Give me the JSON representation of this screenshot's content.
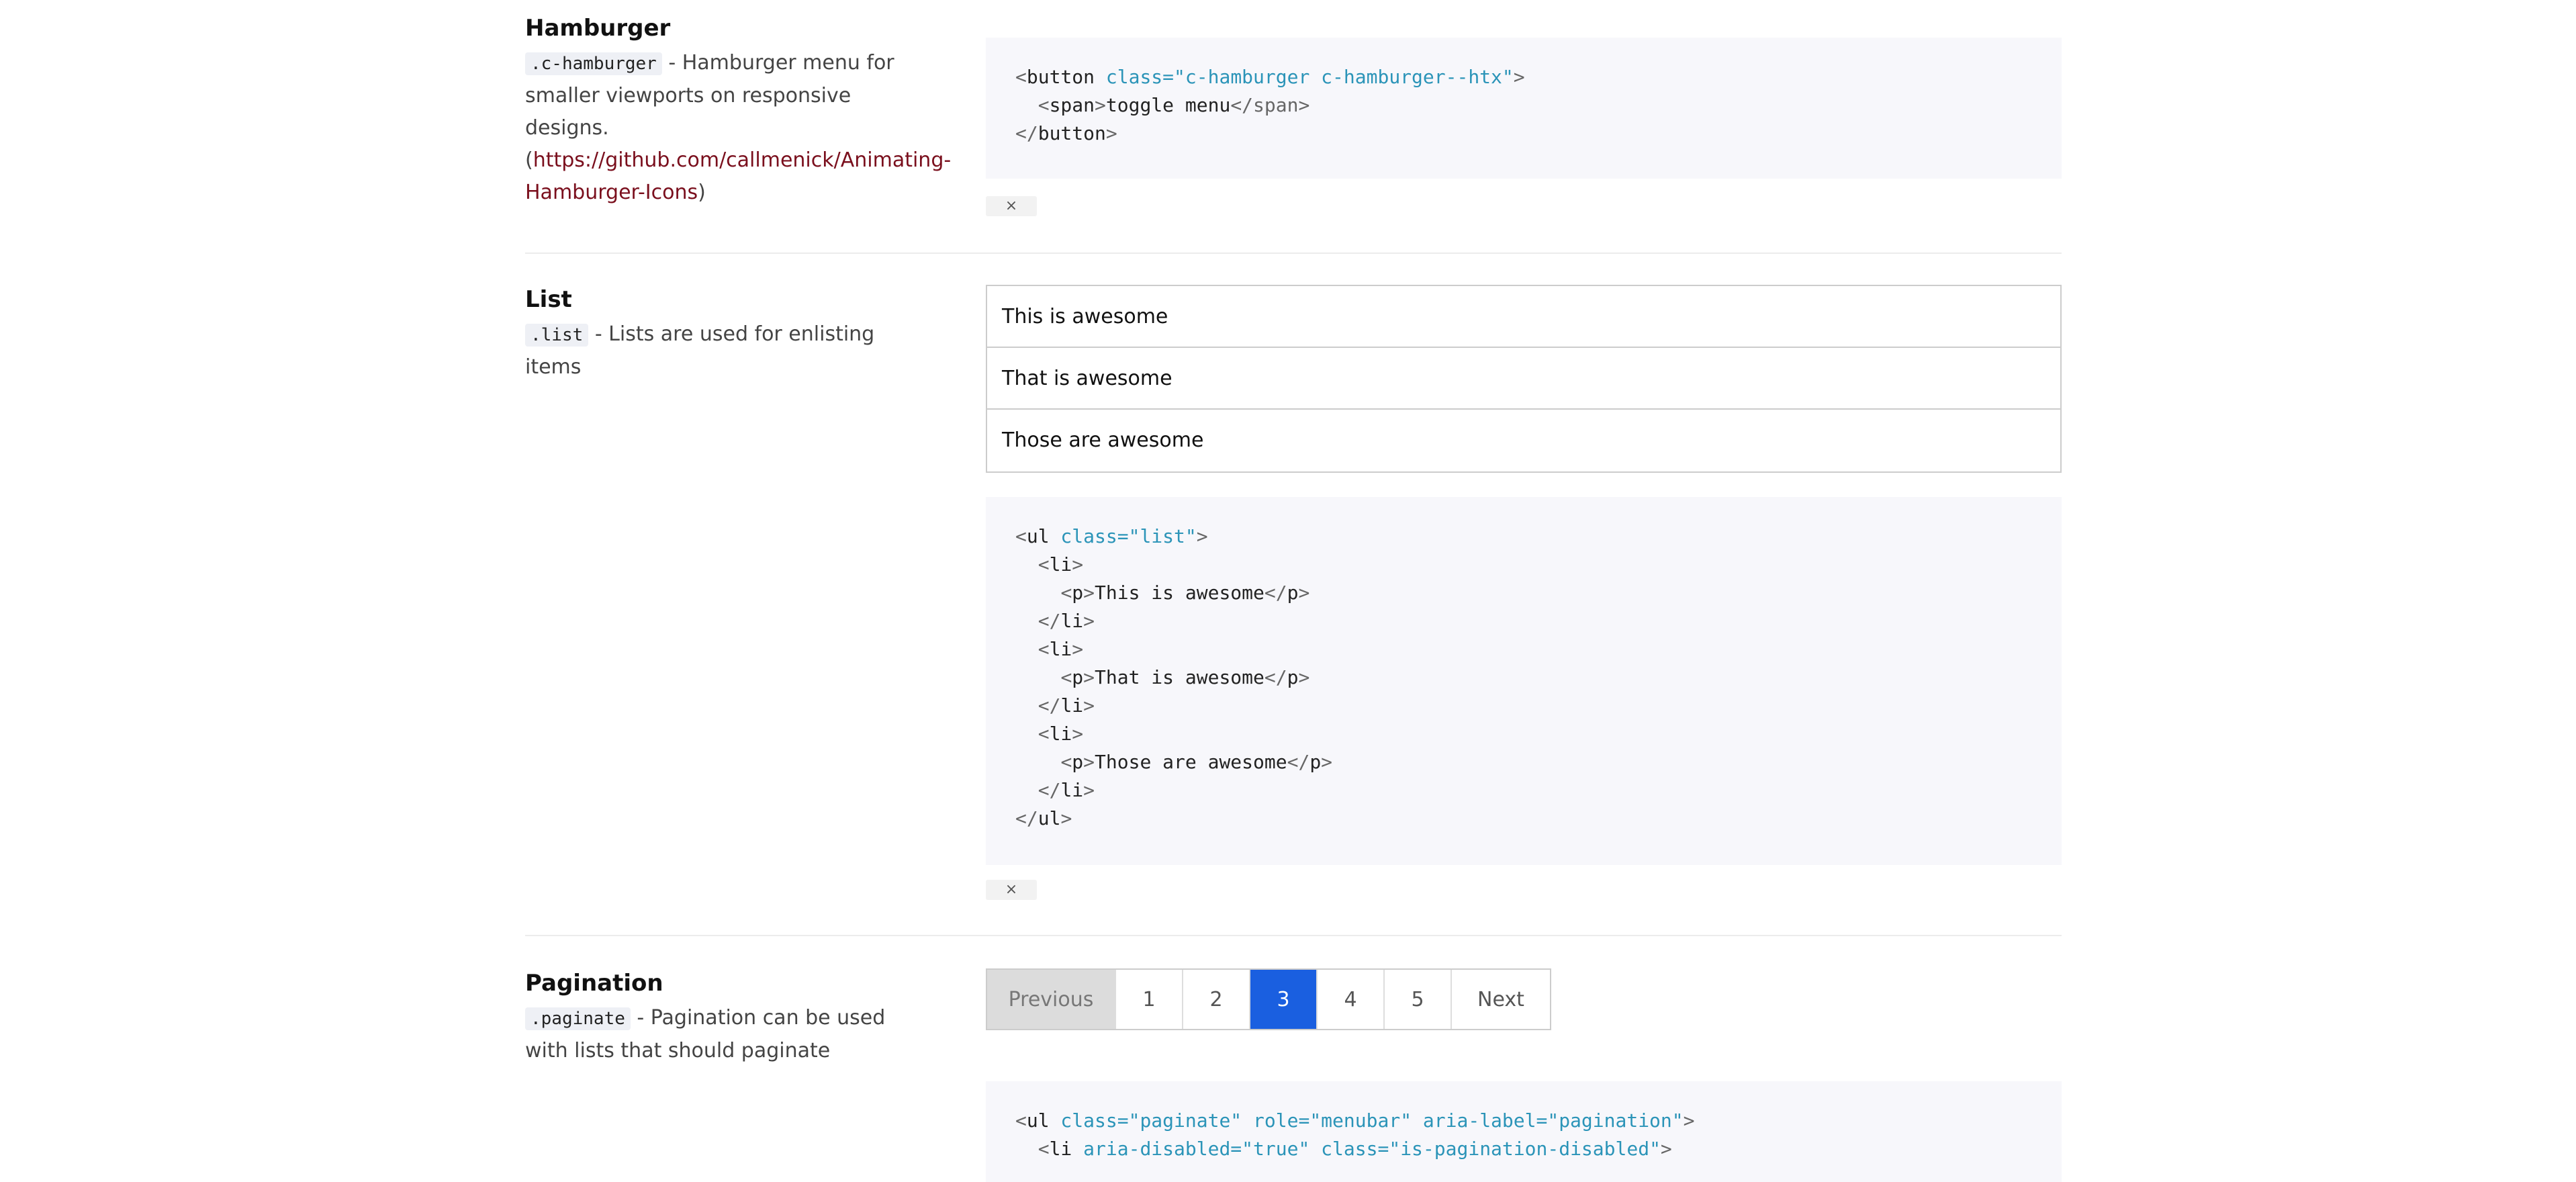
{
  "hamburger": {
    "title": "Hamburger",
    "class_name": ".c-hamburger",
    "desc_part1": " - Hamburger menu for smaller viewports on responsive designs. (",
    "link": "https://github.com/callmenick/Animating-Hamburger-Icons",
    "desc_part2": ")",
    "code": {
      "l1_open": "<",
      "l1_tag": "button",
      "l1_attr": " class=",
      "l1_val": "\"c-hamburger c-hamburger--htx\"",
      "l1_close": ">",
      "l2_open": "  <",
      "l2_tag": "span",
      "l2_close": ">",
      "l2_text": "toggle menu",
      "l2_end": "</span>",
      "l3_open": "</",
      "l3_tag": "button",
      "l3_close": ">"
    },
    "close_glyph": "×"
  },
  "list": {
    "title": "List",
    "class_name": ".list",
    "desc": " - Lists are used for enlisting items",
    "items": [
      "This is awesome",
      "That is awesome",
      "Those are awesome"
    ],
    "code_lines": {
      "l1_tag": "ul",
      "l1_attr": " class=",
      "l1_val": "\"list\"",
      "li": "li",
      "p": "p",
      "t1": "This is awesome",
      "t2": "That is awesome",
      "t3": "Those are awesome"
    },
    "close_glyph": "×"
  },
  "pagination": {
    "title": "Pagination",
    "class_name": ".paginate",
    "desc": " - Pagination can be used with lists that should paginate",
    "previous": "Previous",
    "pages": [
      "1",
      "2",
      "3",
      "4",
      "5"
    ],
    "active": "3",
    "next": "Next",
    "code": {
      "l1_tag": "ul",
      "l1_a1": " class=",
      "l1_v1": "\"paginate\"",
      "l1_a2": " role=",
      "l1_v2": "\"menubar\"",
      "l1_a3": " aria-label=",
      "l1_v3": "\"pagination\"",
      "l2_tag": "li",
      "l2_a1": " aria-disabled=",
      "l2_v1": "\"true\"",
      "l2_a2": " class=",
      "l2_v2": "\"is-pagination-disabled\""
    }
  }
}
